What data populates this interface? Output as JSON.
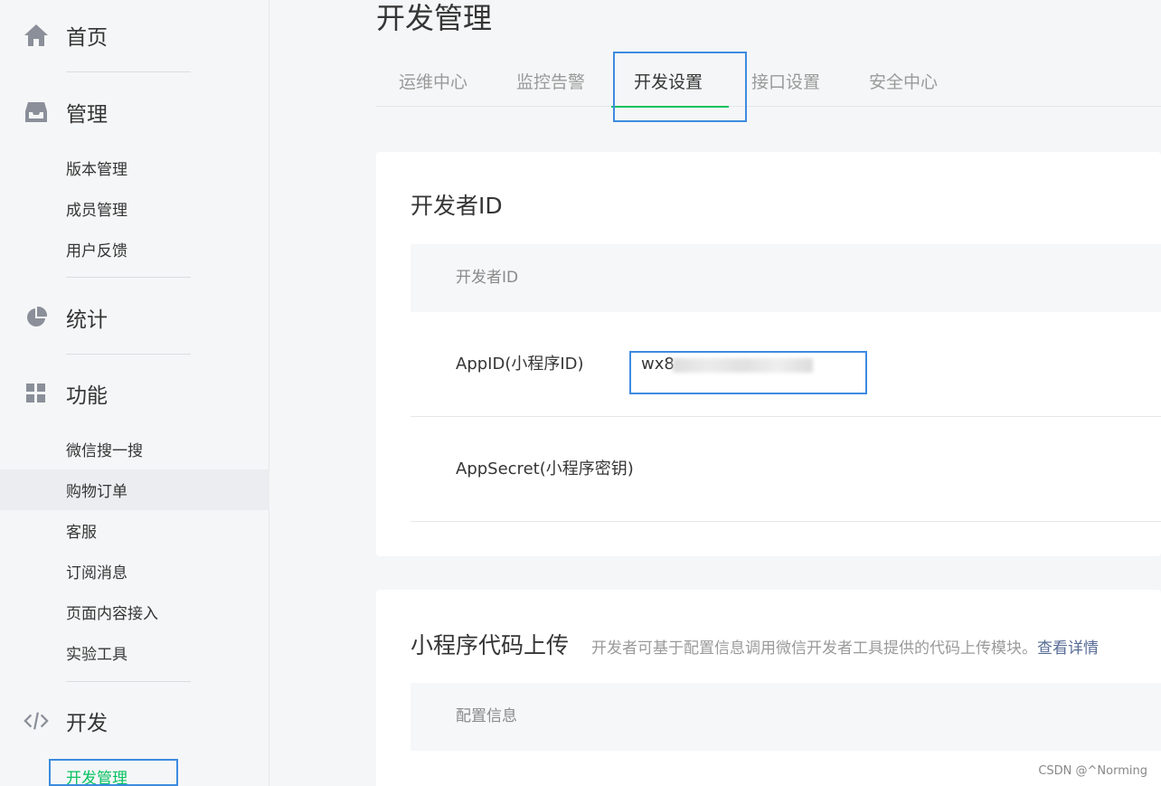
{
  "sidebar": {
    "groups": [
      {
        "label": "首页",
        "icon": "home-icon"
      },
      {
        "label": "管理",
        "icon": "inbox-icon",
        "items": [
          "版本管理",
          "成员管理",
          "用户反馈"
        ]
      },
      {
        "label": "统计",
        "icon": "pie-chart-icon"
      },
      {
        "label": "功能",
        "icon": "grid-icon",
        "items": [
          "微信搜一搜",
          "购物订单",
          "客服",
          "订阅消息",
          "页面内容接入",
          "实验工具"
        ]
      },
      {
        "label": "开发",
        "icon": "code-icon",
        "items": [
          "开发管理"
        ]
      }
    ]
  },
  "main": {
    "title": "开发管理",
    "tabs": [
      "运维中心",
      "监控告警",
      "开发设置",
      "接口设置",
      "安全中心"
    ],
    "active_tab": "开发设置",
    "developer_card": {
      "title": "开发者ID",
      "table_header": "开发者ID",
      "rows": [
        {
          "key": "AppID(小程序ID)",
          "value": "wx8"
        },
        {
          "key": "AppSecret(小程序密钥)",
          "value": ""
        }
      ]
    },
    "upload_card": {
      "title": "小程序代码上传",
      "description": "开发者可基于配置信息调用微信开发者工具提供的代码上传模块。",
      "link": "查看详情",
      "table_header": "配置信息"
    }
  },
  "watermark": "CSDN @^Norming",
  "colors": {
    "accent": "#07c160",
    "highlight": "#3d8be0",
    "link": "#576b95"
  }
}
